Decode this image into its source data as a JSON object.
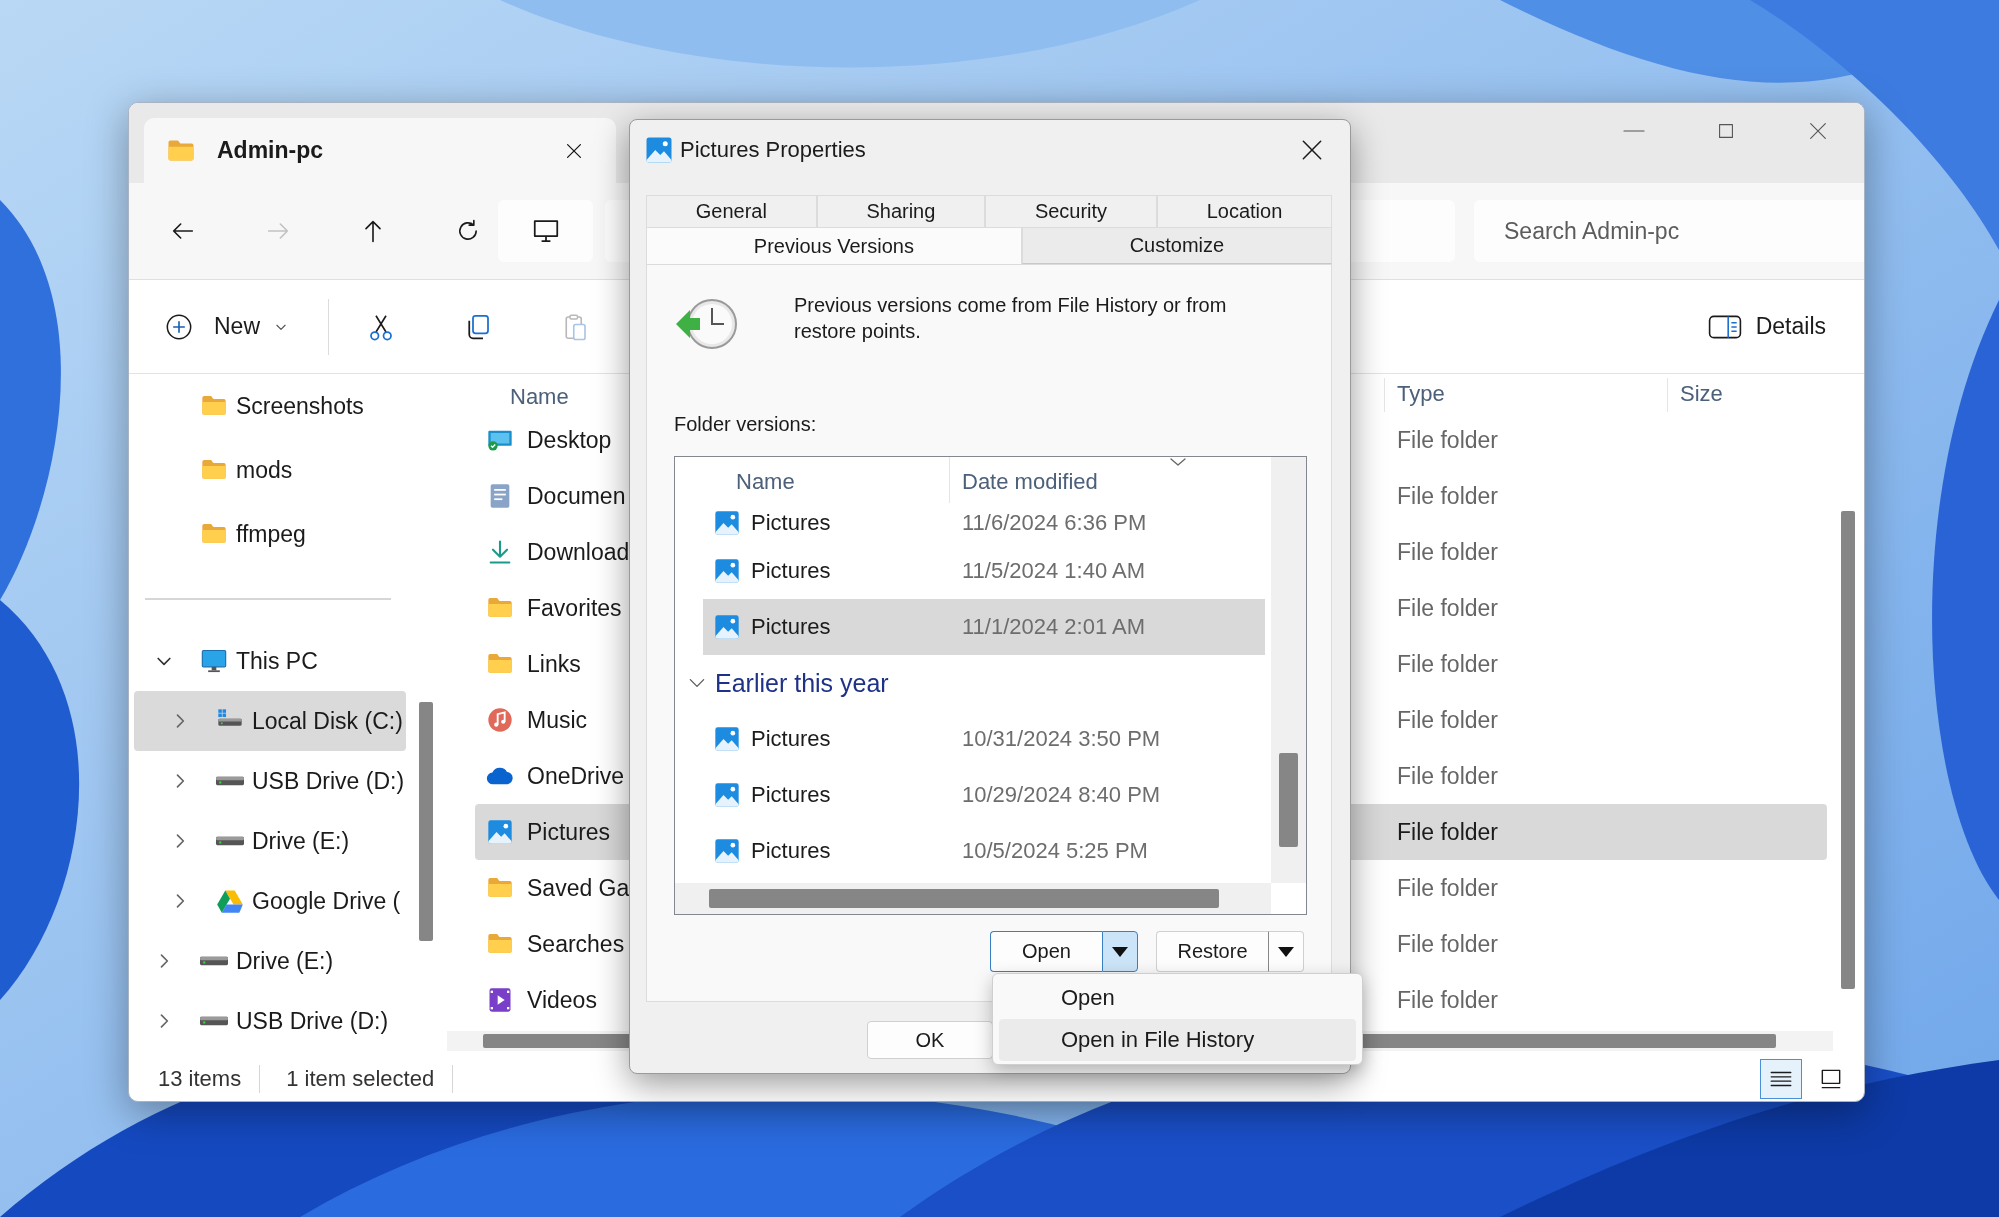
{
  "explorer": {
    "tab": {
      "title": "Admin-pc"
    },
    "nav_buttons": [
      {
        "kind": "back",
        "disabled": false
      },
      {
        "kind": "forward",
        "disabled": true
      },
      {
        "kind": "up",
        "disabled": false
      },
      {
        "kind": "refresh",
        "disabled": false
      },
      {
        "kind": "this-pc",
        "disabled": false
      }
    ],
    "search": {
      "placeholder": "Search Admin-pc"
    },
    "commands": [
      {
        "kind": "new",
        "label": "New",
        "disabled": false
      },
      {
        "kind": "cut",
        "disabled": false
      },
      {
        "kind": "copy",
        "disabled": false
      },
      {
        "kind": "paste",
        "disabled": true
      }
    ],
    "details": {
      "label": "Details"
    },
    "sidebar": {
      "pinned": [
        {
          "label": "Screenshots",
          "kind": "folder",
          "selected": false
        },
        {
          "label": "mods",
          "kind": "folder",
          "selected": false
        },
        {
          "label": "ffmpeg",
          "kind": "folder",
          "selected": false
        }
      ],
      "tree": [
        {
          "label": "This PC",
          "kind": "pc",
          "expanded": true,
          "selected": false,
          "children": [
            {
              "label": "Local Disk (C:)",
              "kind": "system-disk",
              "expanded": false,
              "selected": true
            },
            {
              "label": "USB Drive (D:)",
              "kind": "disk",
              "expanded": false,
              "selected": false
            },
            {
              "label": "Drive (E:)",
              "kind": "disk",
              "expanded": false,
              "selected": false
            },
            {
              "label": "Google Drive (",
              "kind": "cloud-drive",
              "expanded": false,
              "selected": false
            }
          ]
        },
        {
          "label": "Drive (E:)",
          "kind": "disk",
          "expanded": false,
          "selected": false
        },
        {
          "label": "USB Drive (D:)",
          "kind": "disk",
          "expanded": false,
          "selected": false
        }
      ]
    },
    "columns": [
      "Name",
      "Type",
      "Size"
    ],
    "rows": [
      {
        "name": "Desktop",
        "kind": "desktop",
        "type": "File folder",
        "selected": false
      },
      {
        "name": "Documen",
        "kind": "documents",
        "type": "File folder",
        "selected": false
      },
      {
        "name": "Download",
        "kind": "downloads",
        "type": "File folder",
        "selected": false
      },
      {
        "name": "Favorites",
        "kind": "folder",
        "type": "File folder",
        "selected": false
      },
      {
        "name": "Links",
        "kind": "folder",
        "type": "File folder",
        "selected": false
      },
      {
        "name": "Music",
        "kind": "music",
        "type": "File folder",
        "selected": false
      },
      {
        "name": "OneDrive",
        "kind": "cloud",
        "type": "File folder",
        "selected": false
      },
      {
        "name": "Pictures",
        "kind": "pictures",
        "type": "File folder",
        "selected": true
      },
      {
        "name": "Saved Ga",
        "kind": "folder",
        "type": "File folder",
        "selected": false
      },
      {
        "name": "Searches",
        "kind": "folder",
        "type": "File folder",
        "selected": false
      },
      {
        "name": "Videos",
        "kind": "videos",
        "type": "File folder",
        "selected": false
      }
    ],
    "status": {
      "count": "13 items",
      "selection": "1 item selected"
    },
    "views": [
      {
        "kind": "details",
        "selected": true
      },
      {
        "kind": "tiles",
        "selected": false
      }
    ]
  },
  "dialog": {
    "title": "Pictures Properties",
    "tab_rows": [
      [
        {
          "label": "General",
          "selected": false
        },
        {
          "label": "Sharing",
          "selected": false
        },
        {
          "label": "Security",
          "selected": false
        },
        {
          "label": "Location",
          "selected": false
        }
      ],
      [
        {
          "label": "Previous Versions",
          "selected": true
        },
        {
          "label": "Customize",
          "selected": false
        }
      ]
    ],
    "description": "Previous versions come from File History or from restore points.",
    "list_label": "Folder versions:",
    "columns": [
      "Name",
      "Date modified"
    ],
    "groups": [
      {
        "rows": [
          {
            "name": "Pictures",
            "date": "11/6/2024 6:36 PM",
            "selected": false
          },
          {
            "name": "Pictures",
            "date": "11/5/2024 1:40 AM",
            "selected": false
          },
          {
            "name": "Pictures",
            "date": "11/1/2024 2:01 AM",
            "selected": true
          }
        ]
      },
      {
        "title": "Earlier this year",
        "expanded": true,
        "rows": [
          {
            "name": "Pictures",
            "date": "10/31/2024 3:50 PM",
            "selected": false
          },
          {
            "name": "Pictures",
            "date": "10/29/2024 8:40 PM",
            "selected": false
          },
          {
            "name": "Pictures",
            "date": "10/5/2024 5:25 PM",
            "selected": false
          }
        ]
      }
    ],
    "buttons": [
      {
        "label": "Open",
        "menu_open": true
      },
      {
        "label": "Restore",
        "menu_open": false
      }
    ],
    "ok": "OK"
  },
  "menu": [
    {
      "label": "Open",
      "selected": false
    },
    {
      "label": "Open in File History",
      "selected": true
    }
  ]
}
